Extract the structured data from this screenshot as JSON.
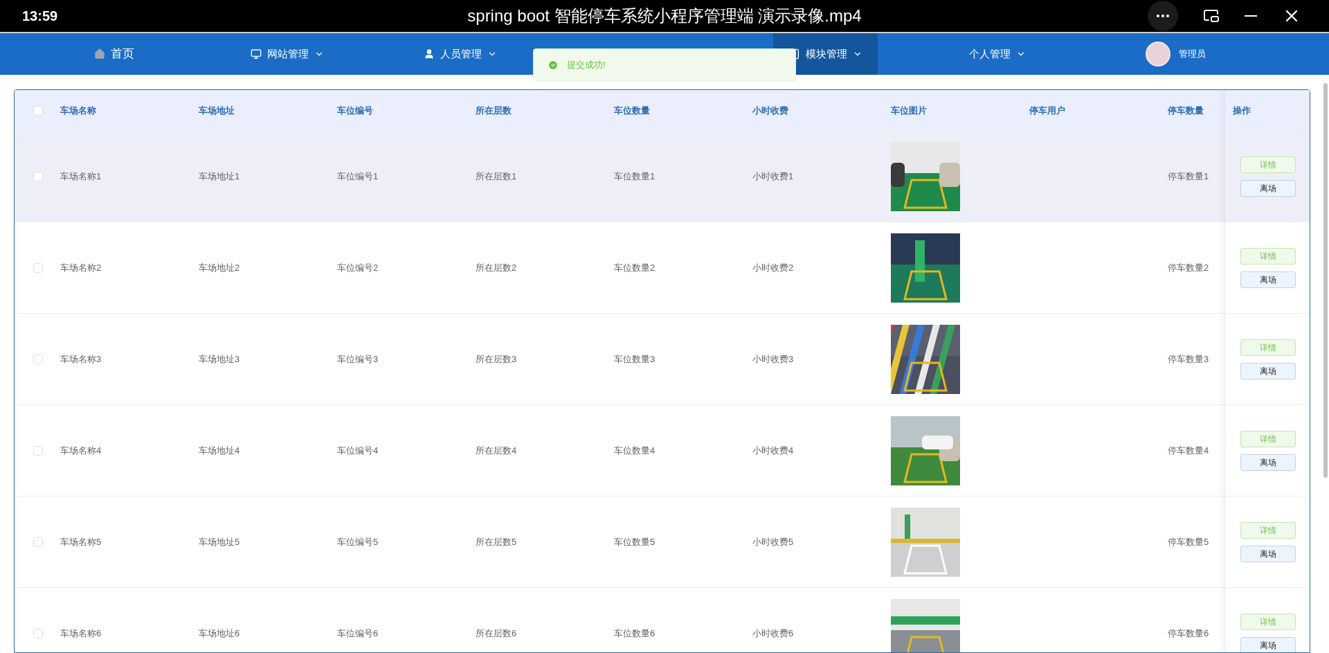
{
  "player": {
    "time": "13:59",
    "title": "spring boot 智能停车系统小程序管理端 演示录像.mp4"
  },
  "nav": {
    "items": [
      {
        "label": "首页",
        "dropdown": false,
        "selected": false
      },
      {
        "label": "网站管理",
        "dropdown": true,
        "selected": false
      },
      {
        "label": "人员管理",
        "dropdown": true,
        "selected": false
      },
      {
        "label": "模块管理",
        "dropdown": true,
        "selected": true
      },
      {
        "label": "个人管理",
        "dropdown": true,
        "selected": false
      }
    ],
    "user": {
      "name": "管理员"
    }
  },
  "toast": {
    "message": "提交成功!"
  },
  "table": {
    "select_all_checked": false,
    "columns": [
      "车场名称",
      "车场地址",
      "车位编号",
      "所在层数",
      "车位数量",
      "小时收费",
      "车位图片",
      "停车用户",
      "停车数量",
      "操作"
    ],
    "rows": [
      {
        "checked": false,
        "highlighted": true,
        "cells": [
          "车场名称1",
          "车场地址1",
          "车位编号1",
          "所在层数1",
          "车位数量1",
          "小时收费1"
        ],
        "count": "停车数量1",
        "actions": [
          "详情",
          "离场"
        ]
      },
      {
        "checked": false,
        "highlighted": false,
        "cells": [
          "车场名称2",
          "车场地址2",
          "车位编号2",
          "所在层数2",
          "车位数量2",
          "小时收费2"
        ],
        "count": "停车数量2",
        "actions": [
          "详情",
          "离场"
        ]
      },
      {
        "checked": false,
        "highlighted": false,
        "cells": [
          "车场名称3",
          "车场地址3",
          "车位编号3",
          "所在层数3",
          "车位数量3",
          "小时收费3"
        ],
        "count": "停车数量3",
        "actions": [
          "详情",
          "离场"
        ]
      },
      {
        "checked": false,
        "highlighted": false,
        "cells": [
          "车场名称4",
          "车场地址4",
          "车位编号4",
          "所在层数4",
          "车位数量4",
          "小时收费4"
        ],
        "count": "停车数量4",
        "actions": [
          "详情",
          "离场"
        ]
      },
      {
        "checked": false,
        "highlighted": false,
        "cells": [
          "车场名称5",
          "车场地址5",
          "车位编号5",
          "所在层数5",
          "车位数量5",
          "小时收费5"
        ],
        "count": "停车数量5",
        "actions": [
          "详情",
          "离场"
        ]
      },
      {
        "checked": false,
        "highlighted": false,
        "cells": [
          "车场名称6",
          "车场地址6",
          "车位编号6",
          "所在层数6",
          "车位数量6",
          "小时收费6"
        ],
        "count": "停车数量6",
        "actions": [
          "详情",
          "离场"
        ]
      }
    ]
  }
}
